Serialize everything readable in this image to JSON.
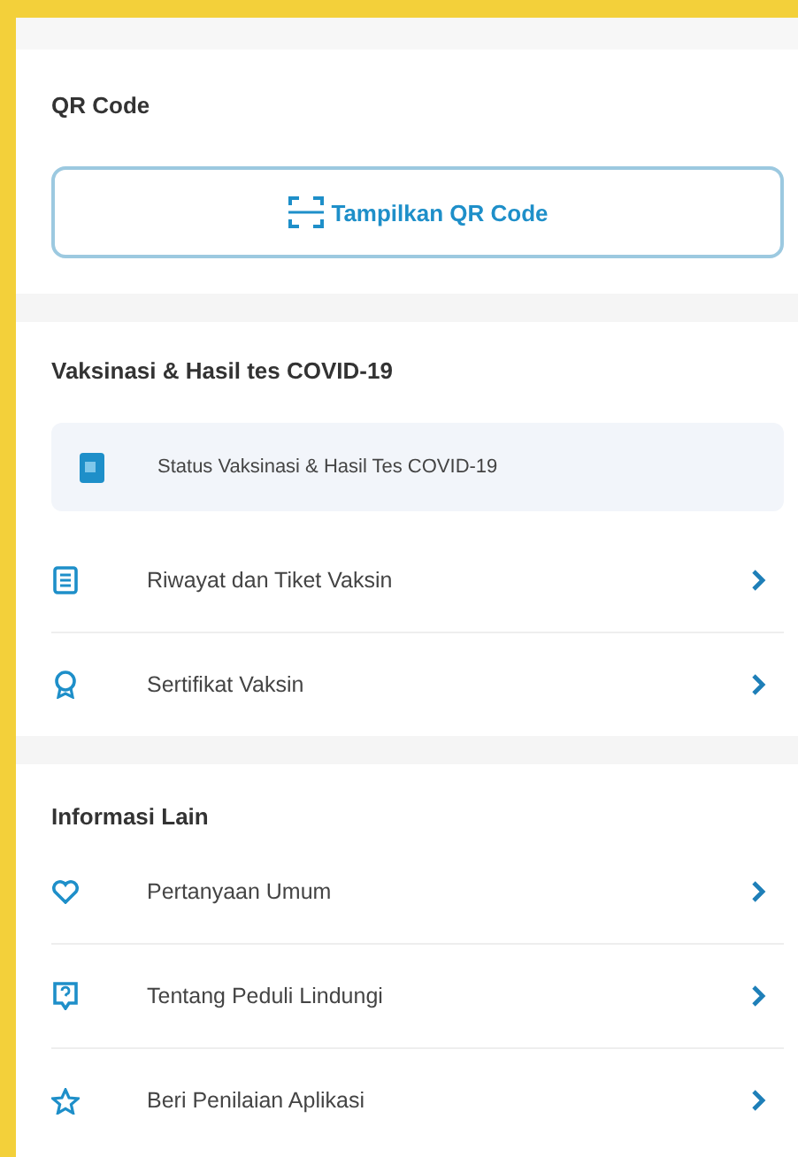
{
  "qr_section": {
    "heading": "QR Code",
    "button": "Tampilkan QR Code"
  },
  "vaccine_section": {
    "heading": "Vaksinasi & Hasil tes COVID-19",
    "status_card": "Status Vaksinasi & Hasil Tes COVID-19",
    "items": [
      {
        "label": "Riwayat dan Tiket Vaksin"
      },
      {
        "label": "Sertifikat Vaksin"
      }
    ]
  },
  "info_section": {
    "heading": "Informasi Lain",
    "items": [
      {
        "label": "Pertanyaan Umum"
      },
      {
        "label": "Tentang Peduli Lindungi"
      },
      {
        "label": "Beri Penilaian Aplikasi"
      }
    ]
  }
}
